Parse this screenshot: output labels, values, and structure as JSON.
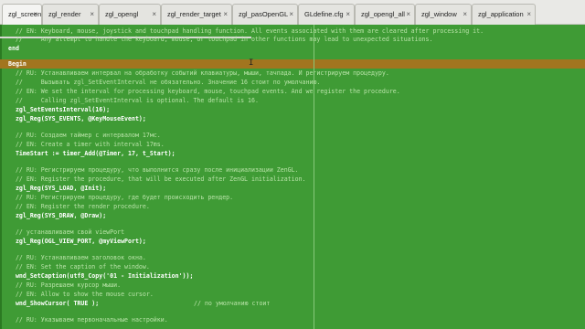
{
  "tabs": [
    {
      "label": "zgl_screen"
    },
    {
      "label": "zgl_render"
    },
    {
      "label": "zgl_opengl"
    },
    {
      "label": "zgl_render_target"
    },
    {
      "label": "zgl_pasOpenGL"
    },
    {
      "label": "GLdefine.cfg"
    },
    {
      "label": "zgl_opengl_all"
    },
    {
      "label": "zgl_window"
    },
    {
      "label": "zgl_application"
    }
  ],
  "code": {
    "l1": "  // EN: Keyboard, mouse, joystick and touchpad handling function. All events associated with them are cleared after processing it.",
    "l2": "  //     Any attempt to handle the keyboard, mouse, or touchpad in other functions may lead to unexpected situations.",
    "l3": "end",
    "l4": "Begin",
    "l5": "  // RU: Устанавливаем интервал на обработку событий клавиатуры, мыши, тачпада. И регистрируем процедуру.",
    "l6": "  //     Вызывать zgl_SetEventInterval не обязательно. Значение 16 стоит по умолчанию.",
    "l7": "  // EN: We set the interval for processing keyboard, mouse, touchpad events. And we register the procedure.",
    "l8": "  //     Calling zgl_SetEventInterval is optional. The default is 16.",
    "l9": "  zgl_SetEventsInterval(16);",
    "l10": "  zgl_Reg(SYS_EVENTS, @KeyMouseEvent);",
    "l11": "  // RU: Создаем таймер с интервалом 17мс.",
    "l12": "  // EN: Create a timer with interval 17ms.",
    "l13": "  TimeStart := timer_Add(@Timer, 17, t_Start);",
    "l14": "  // RU: Регистрируем процедуру, что выполнится сразу после инициализации ZenGL.",
    "l15": "  // EN: Register the procedure, that will be executed after ZenGL initialization.",
    "l16": "  zgl_Reg(SYS_LOAD, @Init);",
    "l17": "  // RU: Регистрируем процедуру, где будет происходить рендер.",
    "l18": "  // EN: Register the render procedure.",
    "l19": "  zgl_Reg(SYS_DRAW, @Draw);",
    "l20": "  // устанавливаем свой viewPort",
    "l21": "  zgl_Reg(OGL_VIEW_PORT, @myViewPort);",
    "l22": "  // RU: Устанавливаем заголовок окна.",
    "l23": "  // EN: Set the caption of the window.",
    "l24": "  wnd_SetCaption(utf8_Copy('01 - Initialization'));",
    "l25": "  // RU: Разрешаем курсор мыши.",
    "l26": "  // EN: Allow to show the mouse cursor.",
    "l27": "  wnd_ShowCursor( TRUE );",
    "l27b": "// по умолчанию стоит",
    "l28": "  // RU: Указываем первоначальные настройки."
  },
  "colors": {
    "background": "#3f9b35",
    "current_line": "#a2751f"
  }
}
